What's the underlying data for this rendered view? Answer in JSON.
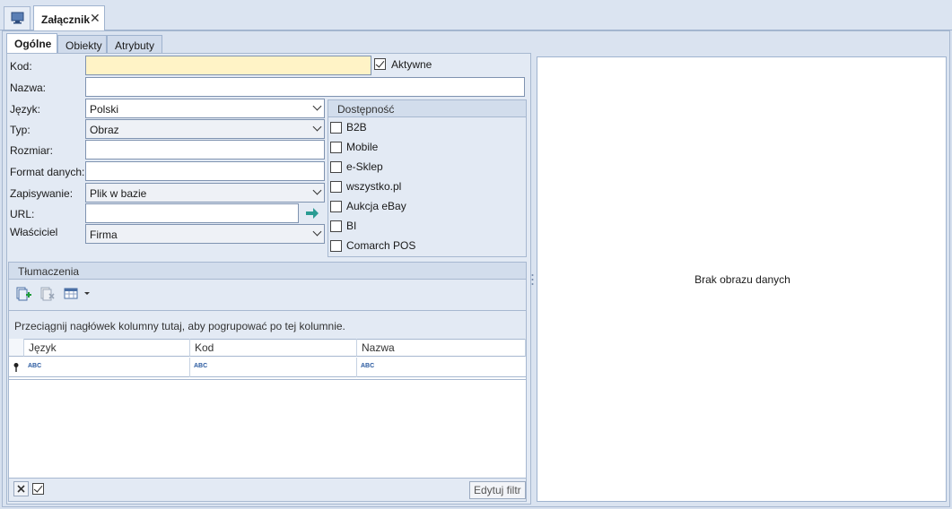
{
  "window": {
    "tab_title": "Załącznik",
    "close_glyph": "✕"
  },
  "tabs": [
    {
      "label": "Ogólne",
      "active": true
    },
    {
      "label": "Obiekty",
      "active": false
    },
    {
      "label": "Atrybuty",
      "active": false
    }
  ],
  "form": {
    "kod_label": "Kod:",
    "kod_value": "",
    "aktywne_label": "Aktywne",
    "aktywne_checked": true,
    "nazwa_label": "Nazwa:",
    "nazwa_value": "",
    "jezyk_label": "Język:",
    "jezyk_value": "Polski",
    "typ_label": "Typ:",
    "typ_value": "Obraz",
    "rozmiar_label": "Rozmiar:",
    "rozmiar_value": "",
    "format_label": "Format danych:",
    "format_value": "",
    "zapisywanie_label": "Zapisywanie:",
    "zapisywanie_value": "Plik w bazie",
    "url_label": "URL:",
    "url_value": "",
    "wlasciciel_label": "Właściciel",
    "wlasciciel_value": "Firma"
  },
  "dostepnosc": {
    "title": "Dostępność",
    "items": [
      {
        "label": "B2B",
        "checked": false
      },
      {
        "label": "Mobile",
        "checked": false
      },
      {
        "label": "e-Sklep",
        "checked": false
      },
      {
        "label": "wszystko.pl",
        "checked": false
      },
      {
        "label": "Aukcja eBay",
        "checked": false
      },
      {
        "label": "BI",
        "checked": false
      },
      {
        "label": "Comarch POS",
        "checked": false
      }
    ]
  },
  "tlumaczenia": {
    "title": "Tłumaczenia",
    "group_hint": "Przeciągnij nagłówek kolumny tutaj, aby pogrupować po tej kolumnie.",
    "columns": [
      "Język",
      "Kod",
      "Nazwa"
    ],
    "filter_row_glyph": "ABC",
    "edit_filter_label": "Edytuj filtr"
  },
  "preview": {
    "empty_message": "Brak obrazu danych"
  }
}
